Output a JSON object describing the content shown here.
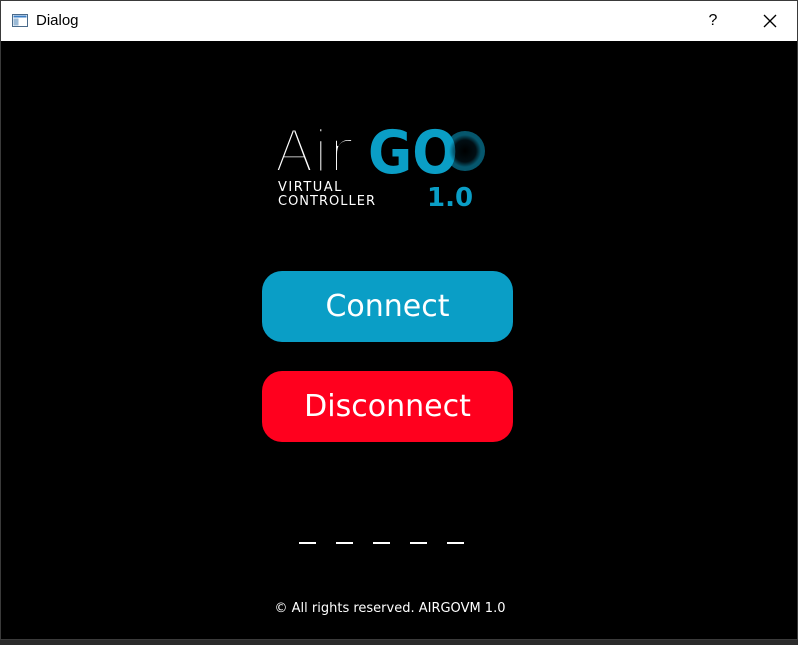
{
  "window": {
    "title": "Dialog",
    "help_label": "?",
    "close_icon": "close-icon",
    "app_icon": "window-icon"
  },
  "logo": {
    "air": "Air",
    "go": "GO",
    "line1": "VIRTUAL",
    "line2": "CONTROLLER",
    "version": "1.0",
    "colors": {
      "air": "#ffffff",
      "go": "#0a9ec6"
    }
  },
  "buttons": {
    "connect_label": "Connect",
    "disconnect_label": "Disconnect",
    "colors": {
      "connect": "#0a9ec6",
      "disconnect": "#ff001e"
    }
  },
  "footer": {
    "text": "© All rights reserved. AIRGOVM 1.0"
  }
}
